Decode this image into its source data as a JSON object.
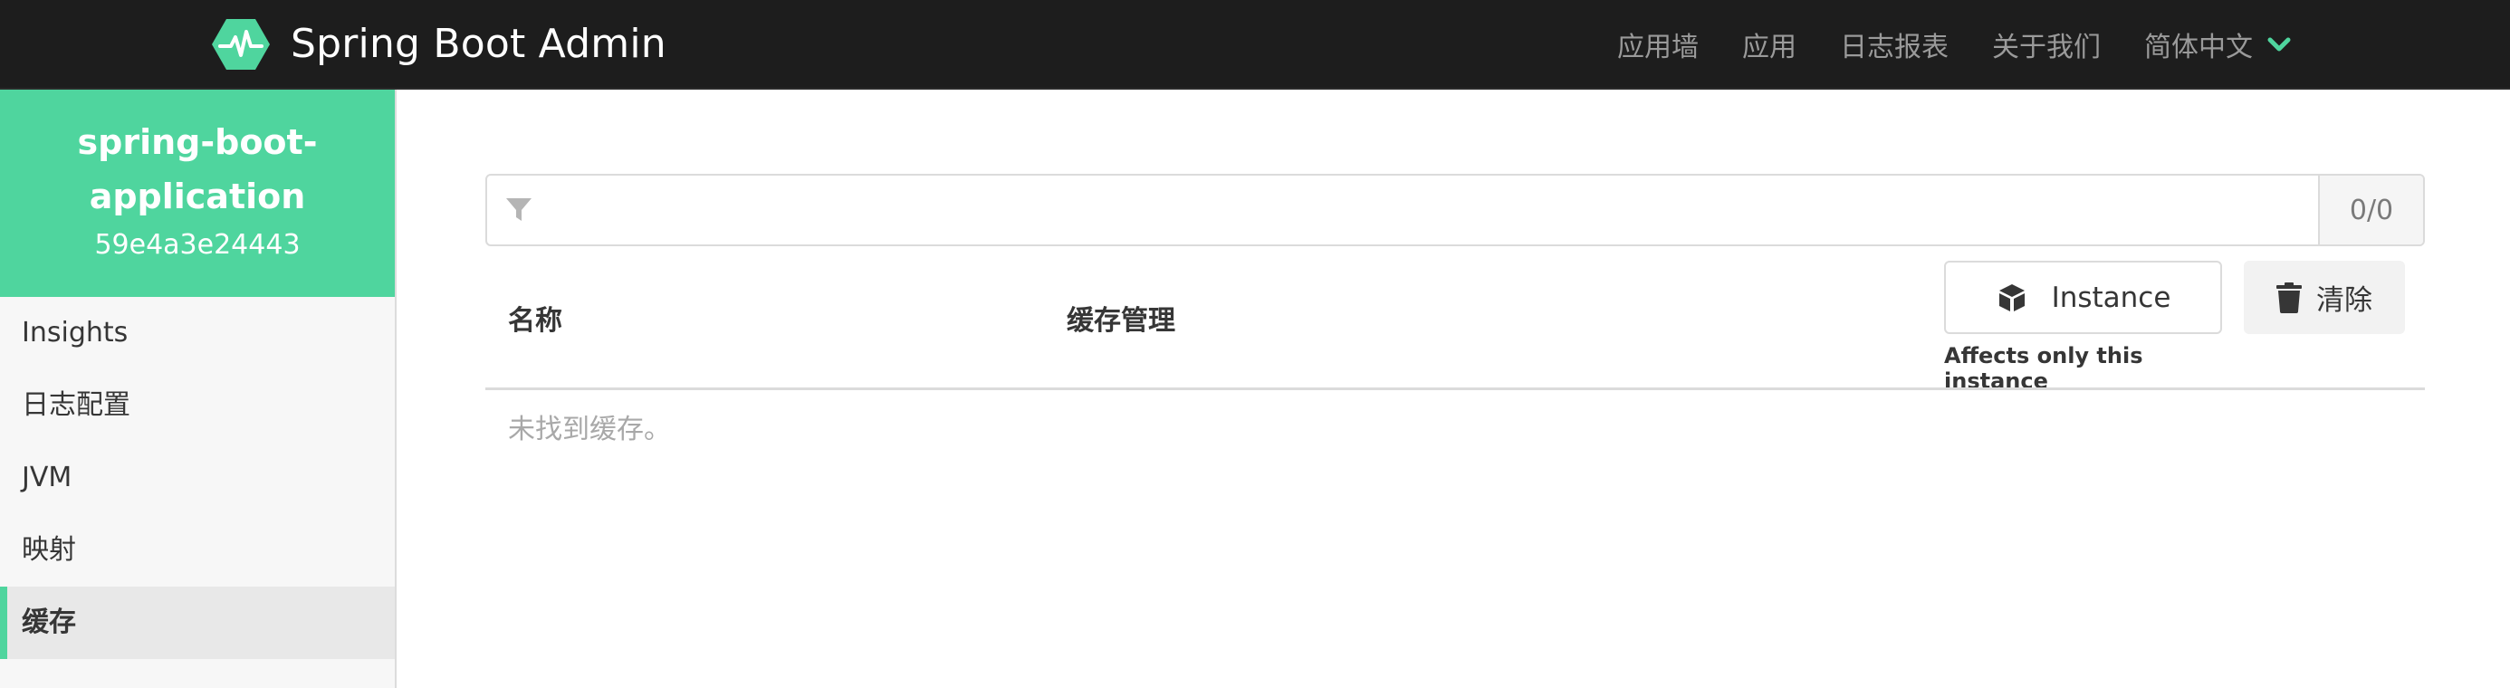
{
  "header": {
    "title": "Spring Boot Admin",
    "logo_icon": "heartbeat-hexagon-icon",
    "nav": [
      {
        "label": "应用墙"
      },
      {
        "label": "应用"
      },
      {
        "label": "日志报表"
      },
      {
        "label": "关于我们"
      }
    ],
    "language": {
      "label": "简体中文",
      "icon": "chevron-down-icon"
    }
  },
  "sidebar": {
    "app_name": "spring-boot-application",
    "instance_id": "59e4a3e24443",
    "items": [
      {
        "label": "Insights"
      },
      {
        "label": "日志配置"
      },
      {
        "label": "JVM"
      },
      {
        "label": "映射"
      },
      {
        "label": "缓存",
        "active": true
      }
    ]
  },
  "main": {
    "filter": {
      "value": "",
      "placeholder": "",
      "count": "0/0",
      "icon": "filter-icon"
    },
    "table": {
      "columns": [
        "名称",
        "缓存管理"
      ],
      "empty_message": "未找到缓存。"
    },
    "actions": {
      "instance_label": "Instance",
      "instance_icon": "cube-icon",
      "instance_note": "Affects only this instance",
      "clear_label": "清除",
      "clear_icon": "trash-icon"
    }
  },
  "colors": {
    "accent": "#4fd59e",
    "topbar": "#1d1d1d",
    "nav_text": "#9a9a9a"
  }
}
